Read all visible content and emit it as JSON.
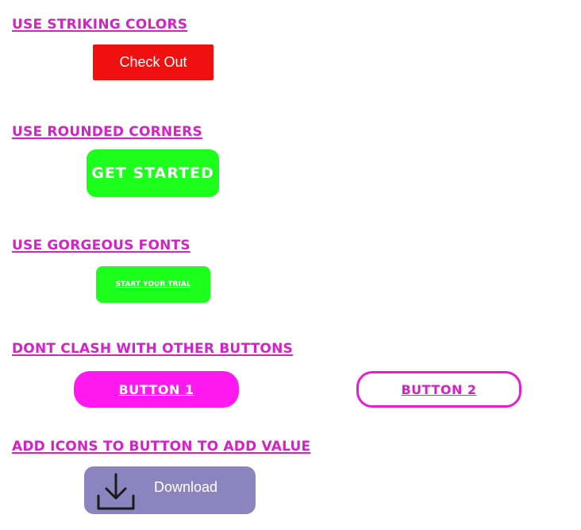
{
  "sections": {
    "striking": {
      "heading": "USE STRIKING COLORS",
      "button_label": "Check Out"
    },
    "rounded": {
      "heading": "USE ROUNDED CORNERS",
      "button_label": "GET STARTED"
    },
    "fonts": {
      "heading": "USE GORGEOUS FONTS",
      "button_label": "START YOUR TRIAL"
    },
    "clash": {
      "heading": "DONT CLASH WITH OTHER BUTTONS",
      "button1_label": "BUTTON 1",
      "button2_label": "BUTTON 2"
    },
    "icons": {
      "heading": "ADD ICONS TO BUTTON TO ADD VALUE",
      "button_label": "Download",
      "icon": "download-icon"
    }
  },
  "colors": {
    "heading": "#d91fc9",
    "red_button": "#f01010",
    "green_button": "#1cff1c",
    "magenta_button": "#ff19f0",
    "download_button": "#8b84bf"
  }
}
